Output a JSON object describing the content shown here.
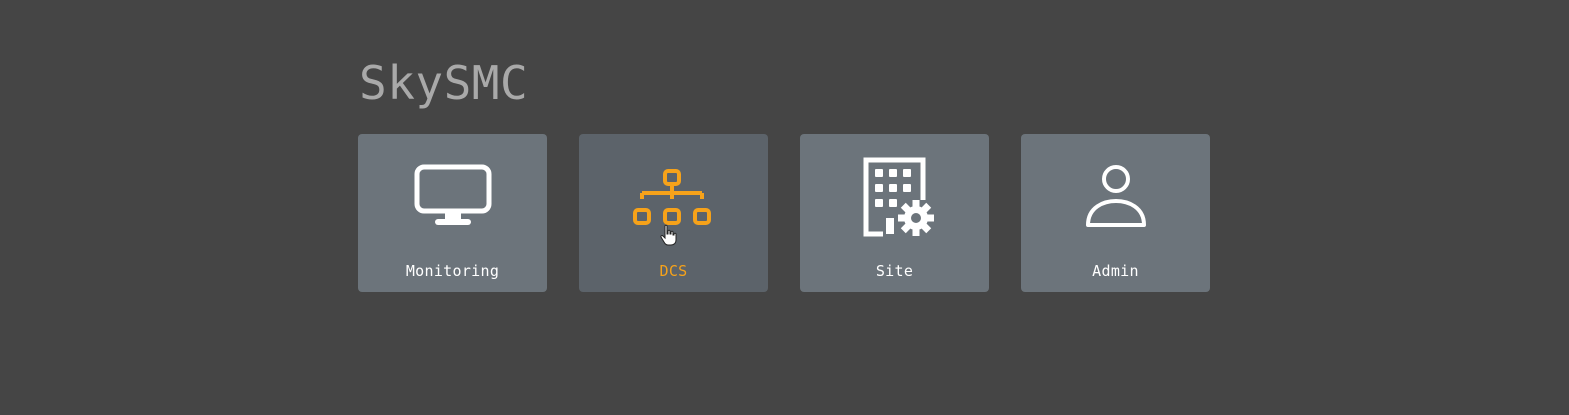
{
  "app": {
    "title": "SkySMC"
  },
  "colors": {
    "background": "#454545",
    "title": "#a9a9a9",
    "tile": "#6c747b",
    "tile_active": "#5c636a",
    "accent": "#f6a21a",
    "icon": "#ffffff"
  },
  "tiles": [
    {
      "label": "Monitoring",
      "icon": "monitor-icon",
      "active": false
    },
    {
      "label": "DCS",
      "icon": "network-hierarchy-icon",
      "active": true
    },
    {
      "label": "Site",
      "icon": "building-gear-icon",
      "active": false
    },
    {
      "label": "Admin",
      "icon": "user-icon",
      "active": false
    }
  ]
}
